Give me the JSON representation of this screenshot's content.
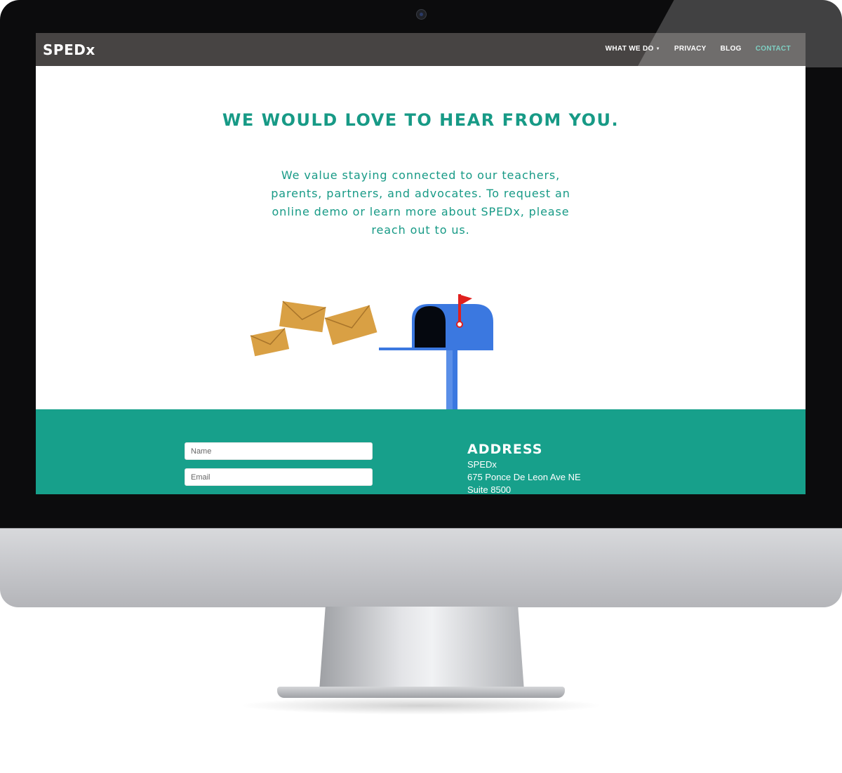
{
  "brand": {
    "logo": "SPEDx"
  },
  "nav": {
    "items": [
      {
        "label": "WHAT WE DO",
        "has_dropdown": true,
        "active": false
      },
      {
        "label": "PRIVACY",
        "has_dropdown": false,
        "active": false
      },
      {
        "label": "BLOG",
        "has_dropdown": false,
        "active": false
      },
      {
        "label": "CONTACT",
        "has_dropdown": false,
        "active": true
      }
    ]
  },
  "hero": {
    "headline": "WE WOULD LOVE TO HEAR FROM YOU.",
    "intro_lines": [
      "We value staying connected to our teachers,",
      "parents, partners, and advocates. To request an",
      "online demo or learn more about SPEDx, please",
      "reach out to us."
    ]
  },
  "form": {
    "name_placeholder": "Name",
    "email_placeholder": "Email"
  },
  "address": {
    "heading": "ADDRESS",
    "lines": [
      "SPEDx",
      "675 Ponce De Leon Ave NE",
      "Suite 8500"
    ]
  },
  "colors": {
    "accent": "#179a86",
    "footer": "#17a08b",
    "navbar": "#474443",
    "active_nav": "#5cc3b3",
    "mailbox": "#3b78e0",
    "flag": "#e0201e",
    "envelope": "#d9a044"
  },
  "icons": {
    "dropdown": "caret-down-icon",
    "illustration": "mailbox-illustration"
  }
}
